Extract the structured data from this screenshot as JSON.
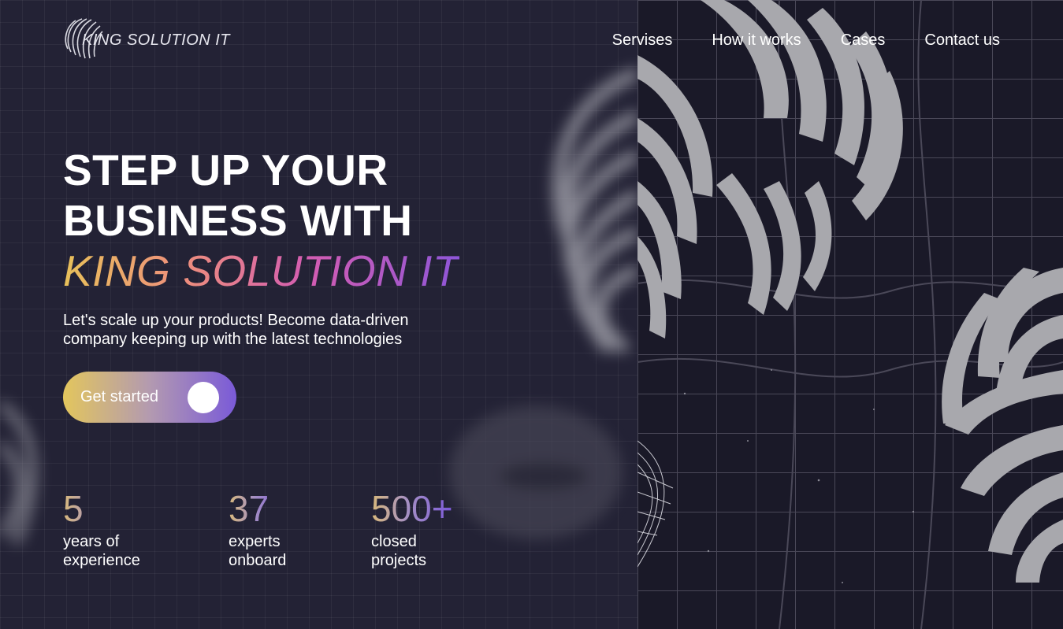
{
  "header": {
    "logo_text": "KING SOLUTION IT",
    "nav": [
      {
        "label": "Servises"
      },
      {
        "label": "How it works"
      },
      {
        "label": "Cases"
      },
      {
        "label": "Contact us"
      }
    ]
  },
  "hero": {
    "title_line1": "STEP UP YOUR",
    "title_line2": "BUSINESS WITH",
    "title_brand": "KING SOLUTION IT",
    "subtitle_line1": "Let's scale up your products! Become data-driven",
    "subtitle_line2": "company keeping up with the latest technologies",
    "cta_label": "Get started"
  },
  "stats": [
    {
      "number": "5",
      "label_line1": "years of",
      "label_line2": "experience"
    },
    {
      "number": "37",
      "label_line1": "experts",
      "label_line2": "onboard"
    },
    {
      "number": "500+",
      "label_line1": "closed",
      "label_line2": "projects"
    }
  ],
  "colors": {
    "background": "#1c1b2b",
    "brand_gradient": [
      "#e8c15a",
      "#ee8f7c",
      "#d35cb2",
      "#8e56d8"
    ],
    "accent_purple": "#7a5ad8",
    "accent_gold": "#e3c65d"
  },
  "icons": {
    "logo": "striped-ring-logo-icon"
  }
}
